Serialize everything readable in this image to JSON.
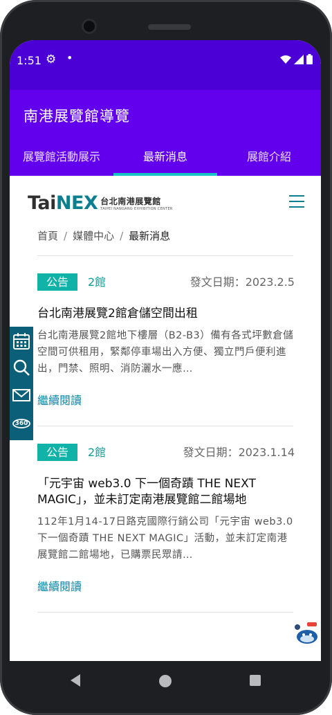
{
  "status_bar": {
    "time": "1:51",
    "settings_icon": "gear-icon",
    "notification_icon": "dot-icon",
    "wifi_icon": "wifi-icon",
    "signal_icon": "signal-icon",
    "battery_icon": "battery-icon"
  },
  "app_bar": {
    "title": "南港展覽館導覽",
    "tabs": [
      {
        "label": "展覽館活動展示",
        "active": false
      },
      {
        "label": "最新消息",
        "active": true
      },
      {
        "label": "展館介紹",
        "active": false
      }
    ],
    "colors": {
      "status": "#4b00d6",
      "bar": "#6200ee",
      "indicator": "#19c4c4"
    }
  },
  "site": {
    "logo": {
      "tai": "Tai",
      "nex": "NEX",
      "zh": "台北南港展覽館",
      "en": "TAIPEI NANGANG EXHIBITION CENTER"
    },
    "menu_icon": "hamburger-menu-icon",
    "breadcrumb": [
      "首頁",
      "媒體中心",
      "最新消息"
    ]
  },
  "news": [
    {
      "tag": "公告",
      "hall": "2館",
      "date": "發文日期：2023.2.5",
      "title": "台北南港展覽2館倉儲空間出租",
      "body": "台北南港展覽2館地下樓層（B2-B3）備有各式坪數倉儲空間可供租用，緊鄰停車場出入方便、獨立門戶便利進出，門禁、照明、消防灑水一應…",
      "read_more": "繼續閱讀"
    },
    {
      "tag": "公告",
      "hall": "2館",
      "date": "發文日期：2023.1.14",
      "title": "「元宇宙 web3.0 下一個奇蹟 THE NEXT MAGIC」，並未訂定南港展覽館二館場地",
      "body": "112年1月14-17日路克國際行銷公司「元宇宙 web3.0 下一個奇蹟 THE NEXT MAGIC」活動，並未訂定南港展覽館二館場地，已購票民眾請…",
      "read_more": "繼續閱讀"
    }
  ],
  "side_tools": [
    "calendar-icon",
    "search-icon",
    "mail-icon",
    "360-view-icon"
  ],
  "nav": {
    "back": "back-icon",
    "home": "home-icon",
    "recent": "recent-apps-icon"
  }
}
